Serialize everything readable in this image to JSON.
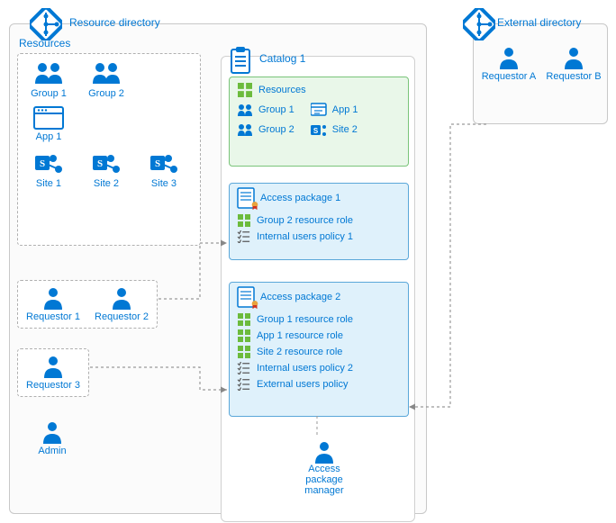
{
  "diagram": {
    "resource_directory_title": "Resource directory",
    "resources_label": "Resources",
    "groups": [
      "Group 1",
      "Group 2"
    ],
    "apps": [
      "App 1"
    ],
    "sites": [
      "Site 1",
      "Site 2",
      "Site 3"
    ],
    "internal_requestors_box1": [
      "Requestor 1",
      "Requestor 2"
    ],
    "internal_requestors_box2": [
      "Requestor 3"
    ],
    "admin_label": "Admin",
    "catalog": {
      "title": "Catalog 1",
      "resources_label": "Resources",
      "resources_col1": [
        "Group 1",
        "Group 2"
      ],
      "resources_col2": [
        "App 1",
        "Site 2"
      ],
      "package1": {
        "title": "Access package 1",
        "roles": [
          "Group 2 resource role"
        ],
        "policies": [
          "Internal users policy 1"
        ]
      },
      "package2": {
        "title": "Access package 2",
        "roles": [
          "Group 1 resource role",
          "App 1 resource role",
          "Site 2 resource role"
        ],
        "policies": [
          "Internal users policy 2",
          "External users policy"
        ]
      },
      "manager_label": "Access package\nmanager"
    },
    "external_directory_title": "External directory",
    "external_requestors": [
      "Requestor A",
      "Requestor B"
    ]
  },
  "colors": {
    "azure_blue": "#0078d4",
    "green": "#7ac47a"
  }
}
